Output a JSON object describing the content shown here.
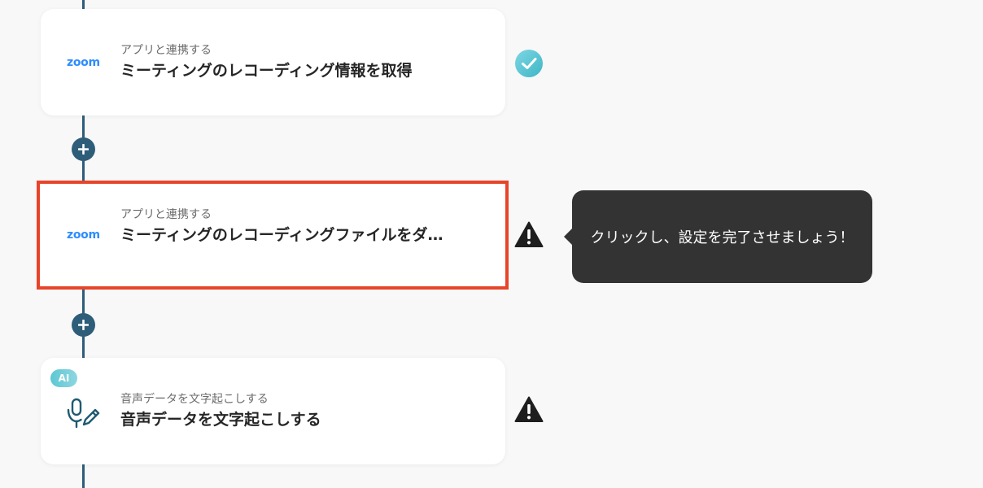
{
  "flow": {
    "steps": [
      {
        "app_logo": "zoom",
        "subtitle": "アプリと連携する",
        "title": "ミーティングのレコーディング情報を取得",
        "status": "complete",
        "status_icon": "check-circle-icon"
      },
      {
        "app_logo": "zoom",
        "subtitle": "アプリと連携する",
        "title": "ミーティングのレコーディングファイルをダ…",
        "status": "warning",
        "status_icon": "warning-triangle-icon",
        "selected": true
      },
      {
        "badge": "AI",
        "app_icon": "microphone-pen-icon",
        "subtitle": "音声データを文字起こしする",
        "title": "音声データを文字起こしする",
        "status": "warning",
        "status_icon": "warning-triangle-icon"
      }
    ],
    "add_step_icon": "plus-icon"
  },
  "tooltip": {
    "text": "クリックし、設定を完了させましょう！"
  },
  "colors": {
    "background": "#f8f8f8",
    "connector": "#2e5d7a",
    "selection": "#e8442a",
    "zoom_blue": "#2d8cff",
    "check_teal": "#4cc3d0",
    "tooltip_bg": "#333333"
  }
}
